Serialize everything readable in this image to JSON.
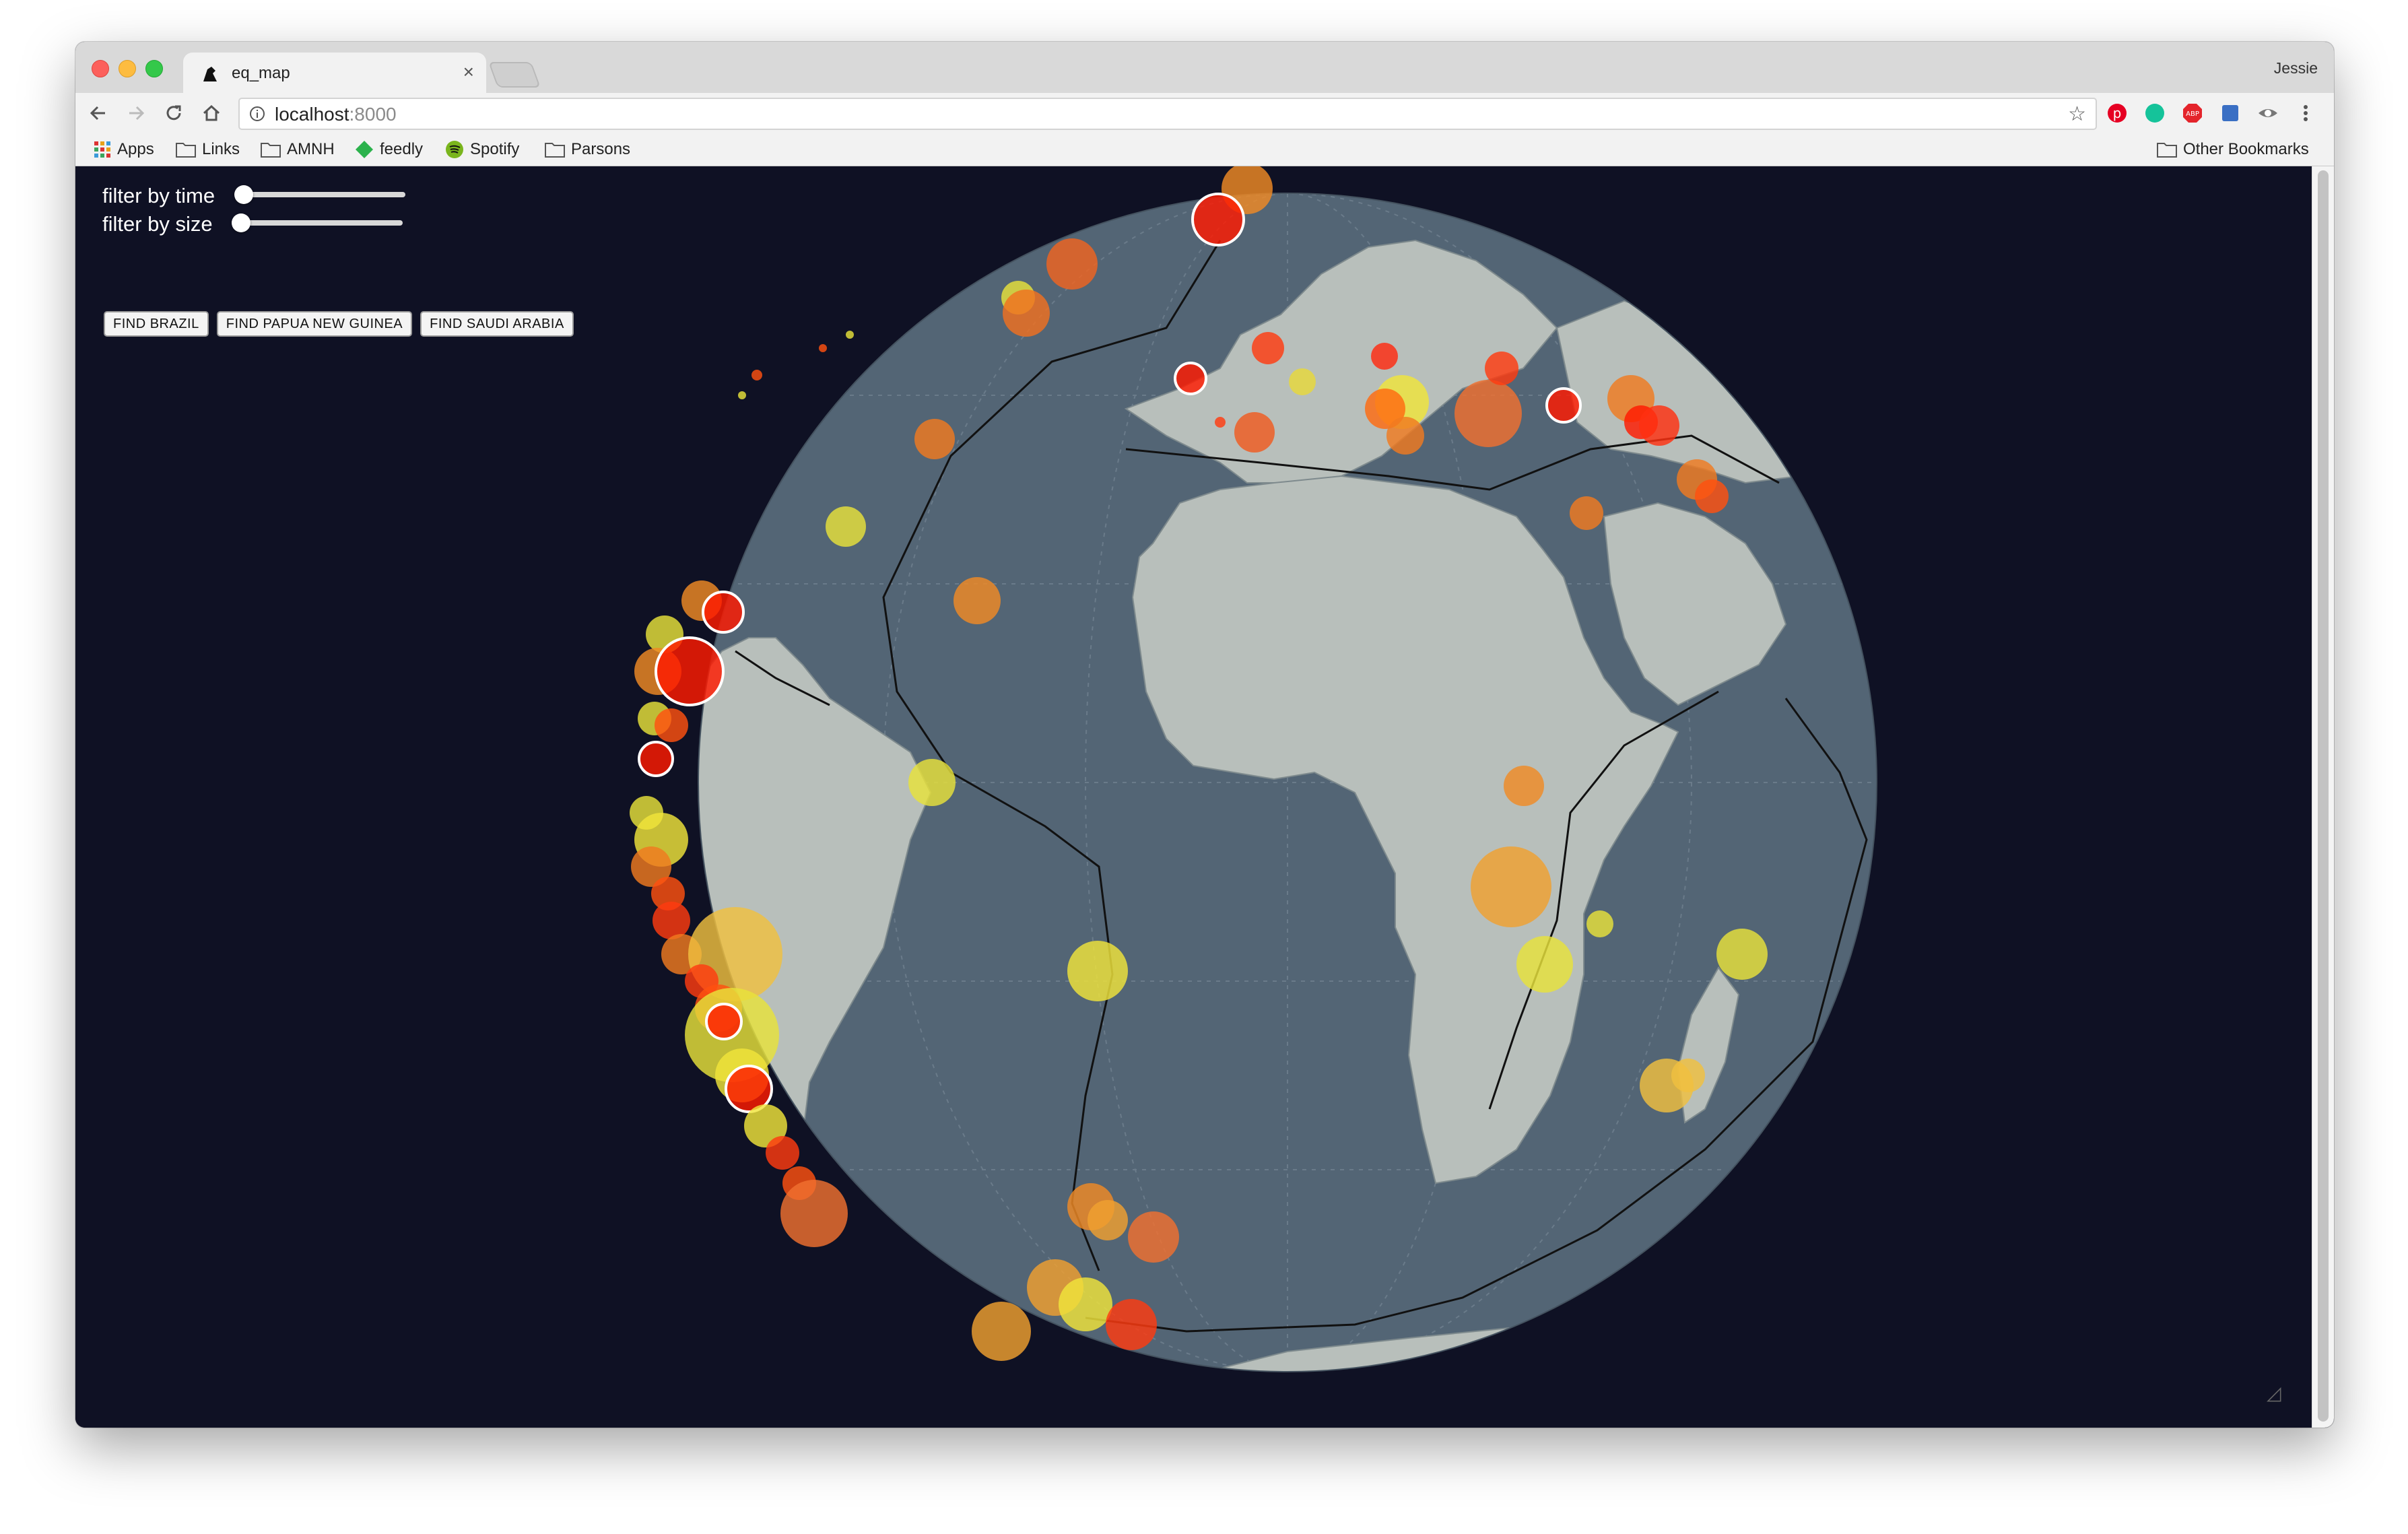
{
  "browser": {
    "tab_title": "eq_map",
    "profile": "Jessie",
    "url_host": "localhost",
    "url_port": ":8000"
  },
  "bookmarks": [
    {
      "label": "Apps",
      "icon": "apps-grid-icon"
    },
    {
      "label": "Links",
      "icon": "folder-icon"
    },
    {
      "label": "AMNH",
      "icon": "folder-icon"
    },
    {
      "label": "feedly",
      "icon": "feedly-icon"
    },
    {
      "label": "Spotify",
      "icon": "spotify-icon"
    },
    {
      "label": "Parsons",
      "icon": "folder-icon"
    }
  ],
  "other_bookmarks": "Other Bookmarks",
  "controls": {
    "time_label": "filter by time",
    "size_label": "filter by size",
    "time_value": 0,
    "size_value": 0
  },
  "buttons": {
    "brazil": "FIND BRAZIL",
    "png": "FIND PAPUA NEW GUINEA",
    "saudi": "FIND SAUDI ARABIA"
  },
  "colors": {
    "background": "#0f1124",
    "ocean": "#536575",
    "land": "#b8bfbb",
    "quake_low": "#f1f13a",
    "quake_mid": "#f08a25",
    "quake_high": "#ff1a00"
  }
}
